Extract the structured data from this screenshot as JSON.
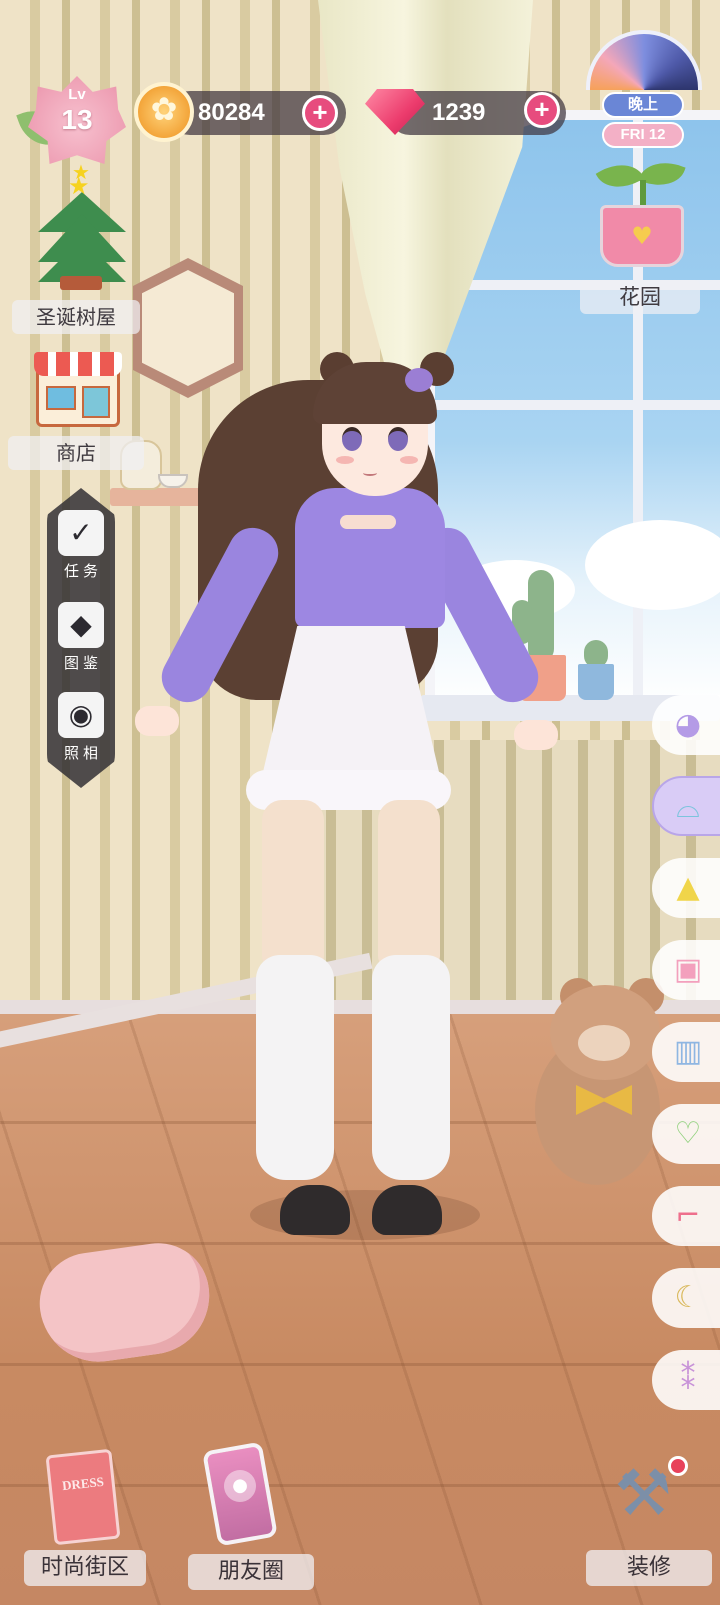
{
  "player": {
    "level_prefix": "Lv",
    "level": "13"
  },
  "currency": {
    "coins": "80284",
    "gems": "1239",
    "add_symbol": "+"
  },
  "time": {
    "period": "晚上",
    "day": "FRI 12"
  },
  "places": {
    "garden": "花园",
    "christmas_house": "圣诞树屋",
    "shop": "商店"
  },
  "left_menu": [
    {
      "icon": "clipboard-check-icon",
      "label": "任务"
    },
    {
      "icon": "collection-book-icon",
      "label": "图鉴"
    },
    {
      "icon": "camera-icon",
      "label": "照相"
    }
  ],
  "wardrobe_tabs": [
    {
      "category": "hair",
      "icon": "hair-icon",
      "active": false
    },
    {
      "category": "hat",
      "icon": "hat-icon",
      "active": true
    },
    {
      "category": "dress",
      "icon": "dress-icon",
      "active": false
    },
    {
      "category": "top",
      "icon": "top-icon",
      "active": false
    },
    {
      "category": "bottoms",
      "icon": "shorts-icon",
      "active": false
    },
    {
      "category": "bag",
      "icon": "handbag-icon",
      "active": false
    },
    {
      "category": "shoes",
      "icon": "high-heel-icon",
      "active": false
    },
    {
      "category": "necklace",
      "icon": "necklace-icon",
      "active": false
    },
    {
      "category": "earrings",
      "icon": "earrings-icon",
      "active": false
    }
  ],
  "bottom_nav": {
    "fashion_street": "时尚街区",
    "friends_circle": "朋友圈",
    "decorate": "装修",
    "dress_card_text": "DRESS"
  },
  "colors": {
    "accent_pink": "#e74c7e",
    "currency_bg": "#3e343e",
    "night_blue": "#6a86d6",
    "day_pink": "#f3b0c6",
    "sweater": "#9d87e2"
  }
}
